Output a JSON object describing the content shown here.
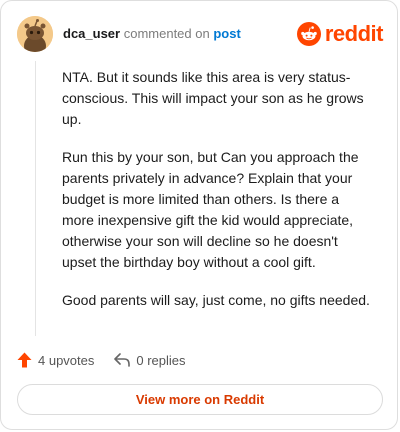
{
  "header": {
    "username": "dca_user",
    "verb": "commented on",
    "link_text": "post",
    "brand": "reddit",
    "icons": {
      "avatar": "snoo-avatar",
      "brand_logo": "reddit-snoo-icon"
    }
  },
  "comment": {
    "paragraphs": [
      "NTA. But it sounds like this area is very status-conscious. This will impact your son as he grows up.",
      "Run this by your son, but Can you approach the parents privately in advance? Explain that your budget is more limited than others. Is there a more inexpensive gift the kid would appreciate, otherwise your son will decline so he doesn't upset the birthday boy without a cool gift.",
      "Good parents will say, just come, no gifts needed."
    ]
  },
  "actions": {
    "upvotes": "4 upvotes",
    "replies": "0 replies",
    "icons": {
      "upvote": "upvote-arrow-icon",
      "reply": "reply-arrow-icon"
    }
  },
  "footer": {
    "view_more": "View more on Reddit"
  },
  "colors": {
    "brand": "#ff4500",
    "link": "#0079d3",
    "view_more_text": "#d93a00"
  }
}
